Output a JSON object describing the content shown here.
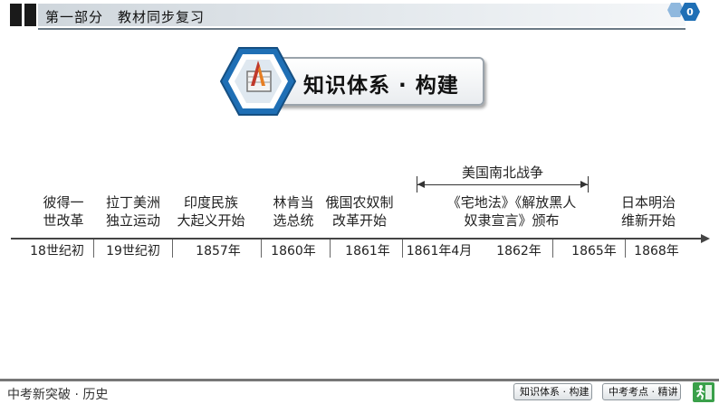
{
  "header": {
    "title": "第一部分　教材同步复习",
    "page_number": "0"
  },
  "banner": {
    "text": "知识体系 · 构建",
    "icon": "pencil-ruler-icon"
  },
  "timeline": {
    "span_label": "美国南北战争",
    "events": [
      {
        "lines": [
          "彼得一",
          "世改革"
        ],
        "date": "18世纪初"
      },
      {
        "lines": [
          "拉丁美洲",
          "独立运动"
        ],
        "date": "19世纪初"
      },
      {
        "lines": [
          "印度民族",
          "大起义开始"
        ],
        "date": "1857年"
      },
      {
        "lines": [
          "林肯当",
          "选总统"
        ],
        "date": "1860年"
      },
      {
        "lines": [
          "俄国农奴制",
          "改革开始"
        ],
        "date": "1861年"
      },
      {
        "lines": [],
        "date": "1861年4月"
      },
      {
        "lines": [
          "《宅地法》《解放黑人",
          "奴隶宣言》颁布"
        ],
        "date": "1862年"
      },
      {
        "lines": [],
        "date": "1865年"
      },
      {
        "lines": [
          "日本明治",
          "维新开始"
        ],
        "date": "1868年"
      }
    ]
  },
  "footer": {
    "brand": "中考新突破 · 历史",
    "buttons": [
      "知识体系 · 构建",
      "中考考点 · 精讲"
    ],
    "exit_icon": "running-man-exit-icon"
  },
  "colors": {
    "hex_blue": "#1f6fb5",
    "exit_green": "#3aa04a"
  }
}
